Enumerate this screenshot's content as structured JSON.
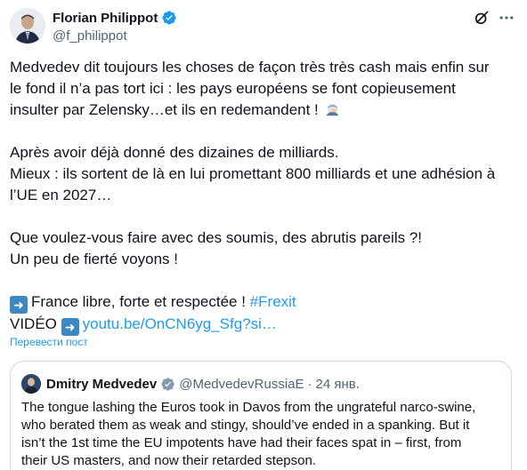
{
  "tweet": {
    "author_name": "Florian Philippot",
    "author_handle": "@f_philippot",
    "lines": [
      "Medvedev dit toujours les choses de façon très très cash mais enfin sur",
      "le fond il n’a pas tort ici : les pays européens se font copieusement",
      "insulter par Zelensky…et ils en redemandent !"
    ],
    "lines2": [
      "Après avoir déjà donné des dizaines de milliards.",
      "Mieux : ils sortent de là en lui promettant 800 milliards et une adhésion à",
      "l’UE en 2027…"
    ],
    "lines3": [
      "Que voulez-vous faire avec des soumis, des abrutis pareils ?!",
      "Un peu de fierté voyons !"
    ],
    "france_line": "France libre, forte et respectée !",
    "hashtag": "#Frexit",
    "video_label": "VIDÉO",
    "video_link": "youtu.be/OnCN6yg_Sfg?si…",
    "translate_label": "Перевести пост"
  },
  "quote": {
    "author_name": "Dmitry Medvedev",
    "author_handle": "@MedvedevRussiaE",
    "separator": "·",
    "date": "24 янв.",
    "lines": [
      "The tongue lashing the Euros took in Davos from the ungrateful narco-swine,",
      "who berated them as weak and stingy, should’ve ended in a spanking. But it",
      "isn’t the 1st time the EU impotents have had their faces spat in – first, from",
      "their US masters, and now their retarded stepson."
    ]
  },
  "colors": {
    "link": "#1d9bf0",
    "secondary_text": "#536471",
    "verified_badge": "#1d9bf0",
    "arrow_emoji": "#3b88c3"
  },
  "icons": [
    "verified-badge-icon",
    "grok-icon",
    "more-icon",
    "facepalm-emoji",
    "right-arrow-emoji"
  ]
}
